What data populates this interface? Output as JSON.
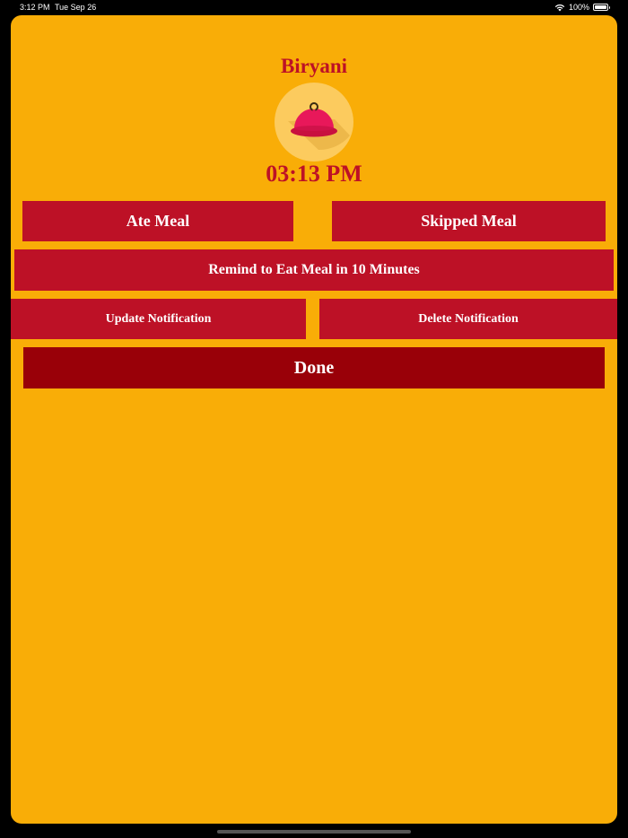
{
  "status_bar": {
    "time": "3:12 PM",
    "date": "Tue Sep 26",
    "battery": "100%"
  },
  "meal": {
    "name": "Biryani",
    "time": "03:13 PM",
    "icon": "food-cloche-icon"
  },
  "actions": {
    "ate": "Ate Meal",
    "skipped": "Skipped Meal",
    "remind": "Remind to Eat Meal in 10 Minutes",
    "update": "Update Notification",
    "delete": "Delete Notification",
    "done": "Done"
  },
  "colors": {
    "background": "#F9AD07",
    "accent": "#BD1126",
    "done_button": "#990008",
    "avatar_circle": "#FCCB5E",
    "cloche": "#E8185A"
  }
}
